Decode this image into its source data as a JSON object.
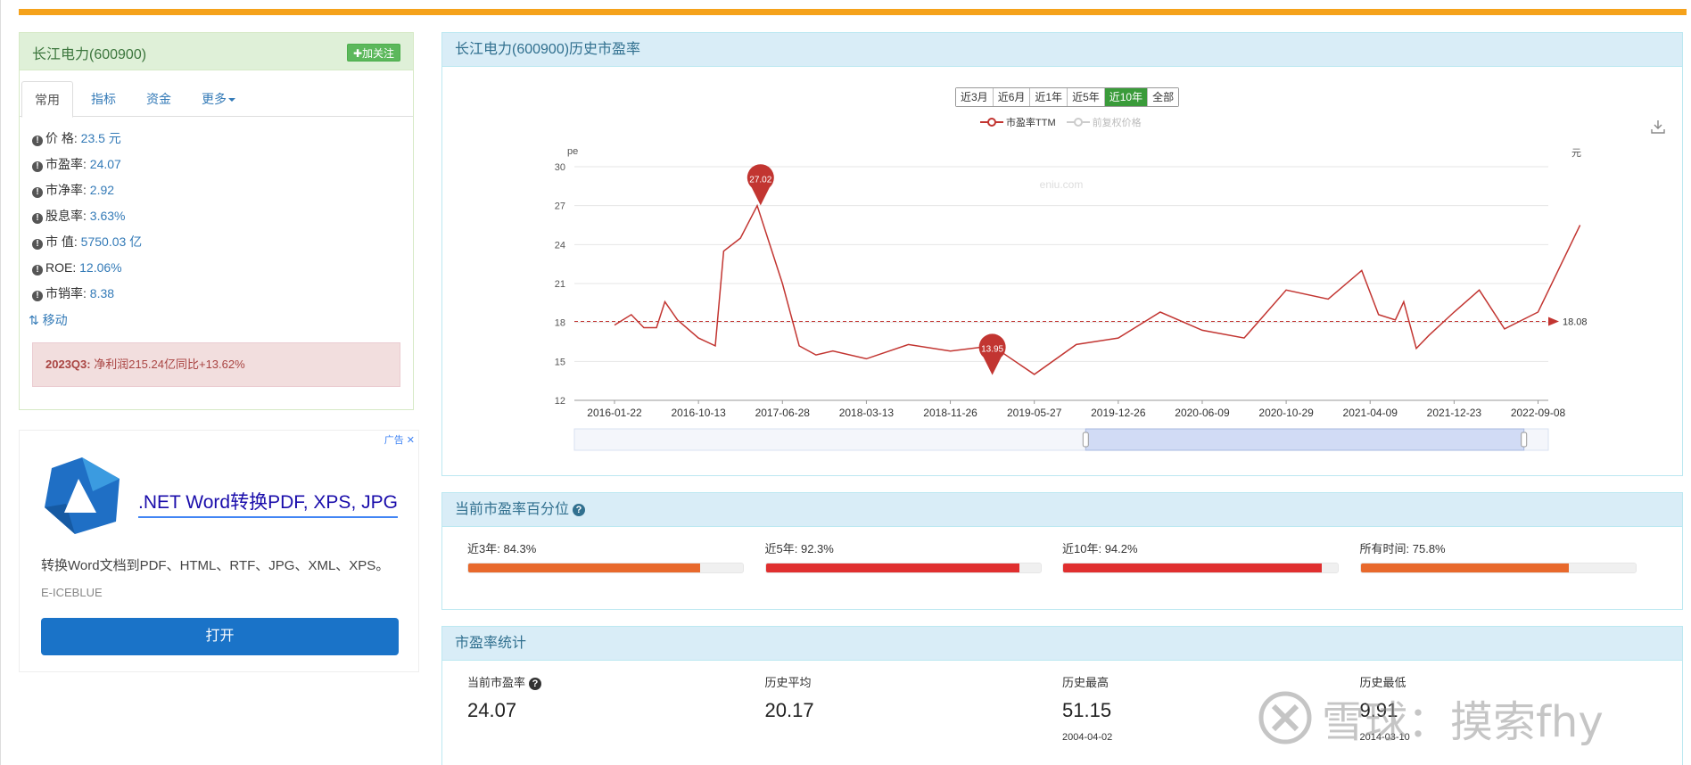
{
  "stock": {
    "name_title": "长江电力(600900)",
    "follow_label": "✚加关注"
  },
  "tabs": [
    {
      "label": "常用"
    },
    {
      "label": "指标"
    },
    {
      "label": "资金"
    },
    {
      "label": "更多"
    }
  ],
  "metrics": [
    {
      "label": "价 格:",
      "value": "23.5 元"
    },
    {
      "label": "市盈率:",
      "value": "24.07"
    },
    {
      "label": "市净率:",
      "value": "2.92"
    },
    {
      "label": "股息率:",
      "value": "3.63%"
    },
    {
      "label": "市 值:",
      "value": "5750.03 亿"
    },
    {
      "label": "ROE:",
      "value": "12.06%"
    },
    {
      "label": "市销率:",
      "value": "8.38"
    }
  ],
  "move_link": "⇅ 移动",
  "quarter": {
    "period": "2023Q3:",
    "text": "净利润215.24亿同比+13.62%"
  },
  "ad": {
    "tag": "广告",
    "title": ".NET Word转换PDF, XPS, JPG",
    "desc": "转换Word文档到PDF、HTML、RTF、JPG、XML、XPS。",
    "brand": "E-ICEBLUE",
    "open_label": "打开"
  },
  "history_panel": {
    "title": "长江电力(600900)历史市盈率",
    "range_buttons": [
      "近3月",
      "近6月",
      "近1年",
      "近5年",
      "近10年",
      "全部"
    ],
    "active_range": "近10年",
    "legend": [
      "市盈率TTM",
      "前复权价格"
    ]
  },
  "chart_data": {
    "type": "line",
    "ylabel_left": "pe",
    "ylabel_right": "元",
    "watermark_text": "eniu.com",
    "y_ticks": [
      12,
      15,
      18,
      21,
      24,
      27,
      30
    ],
    "ylim": [
      12,
      30
    ],
    "x_ticks": [
      "2016-01-22",
      "2016-10-13",
      "2017-06-28",
      "2018-03-13",
      "2018-11-26",
      "2019-05-27",
      "2019-12-26",
      "2020-06-09",
      "2020-10-29",
      "2021-04-09",
      "2021-12-23",
      "2022-09-08"
    ],
    "series": [
      {
        "name": "市盈率TTM",
        "color": "#c23531",
        "x": [
          0,
          0.2,
          0.35,
          0.5,
          0.6,
          0.75,
          1.0,
          1.2,
          1.3,
          1.5,
          1.7,
          2.0,
          2.2,
          2.4,
          2.6,
          3.0,
          3.5,
          4.0,
          4.5,
          5.0,
          5.5,
          6.0,
          6.5,
          7.0,
          7.5,
          8.0,
          8.5,
          8.9,
          9.1,
          9.3,
          9.4,
          9.55,
          9.7,
          10.0,
          10.3,
          10.6,
          11.0,
          11.5
        ],
        "values": [
          17.8,
          18.6,
          17.6,
          17.6,
          19.6,
          18.2,
          16.8,
          16.2,
          23.5,
          24.5,
          27.0,
          21.0,
          16.2,
          15.5,
          15.8,
          15.2,
          16.3,
          15.8,
          16.2,
          14.0,
          16.3,
          16.8,
          18.8,
          17.4,
          16.8,
          20.5,
          19.8,
          22.0,
          18.6,
          18.2,
          19.6,
          16.0,
          17.0,
          18.8,
          20.5,
          17.5,
          18.8,
          25.5
        ]
      }
    ],
    "reference_line": {
      "value": 18.08,
      "label": "18.08"
    },
    "markers": [
      {
        "label": "27.02",
        "x": 1.74,
        "y": 27.02
      },
      {
        "label": "13.95",
        "x": 4.5,
        "y": 13.95
      }
    ]
  },
  "percentile_panel": {
    "title": "当前市盈率百分位",
    "items": [
      {
        "label": "近3年:",
        "pct_text": "84.3%",
        "pct": 84.3,
        "color": "#e8692c"
      },
      {
        "label": "近5年:",
        "pct_text": "92.3%",
        "pct": 92.3,
        "color": "#e02f2f"
      },
      {
        "label": "近10年:",
        "pct_text": "94.2%",
        "pct": 94.2,
        "color": "#e02f2f"
      },
      {
        "label": "所有时间:",
        "pct_text": "75.8%",
        "pct": 75.8,
        "color": "#e8692c"
      }
    ]
  },
  "stats_panel": {
    "title": "市盈率统计",
    "items": [
      {
        "title": "当前市盈率",
        "value": "24.07",
        "date": ""
      },
      {
        "title": "历史平均",
        "value": "20.17",
        "date": ""
      },
      {
        "title": "历史最高",
        "value": "51.15",
        "date": "2004-04-02"
      },
      {
        "title": "历史最低",
        "value": "9.91",
        "date": "2014-03-10"
      }
    ]
  },
  "watermark": "雪球：摸索fhy"
}
